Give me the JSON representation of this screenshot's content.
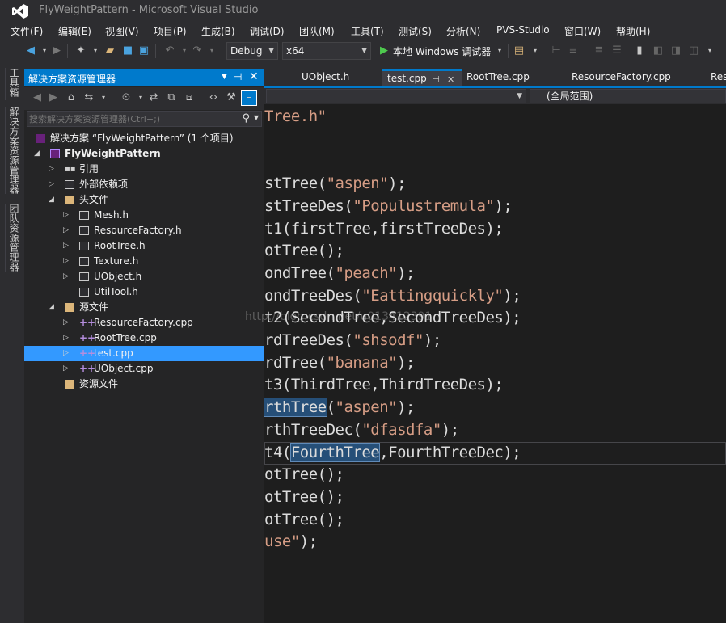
{
  "window": {
    "title": "FlyWeightPattern - Microsoft Visual Studio"
  },
  "menu": [
    "文件(F)",
    "编辑(E)",
    "视图(V)",
    "项目(P)",
    "生成(B)",
    "调试(D)",
    "团队(M)",
    "工具(T)",
    "测试(S)",
    "分析(N)",
    "PVS-Studio",
    "窗口(W)",
    "帮助(H)"
  ],
  "toolbar": {
    "config": "Debug",
    "platform": "x64",
    "debugger": "本地 Windows 调试器"
  },
  "side_tabs": [
    "工具箱",
    "解决方案资源管理器",
    "团队资源管理器"
  ],
  "solution_explorer": {
    "title": "解决方案资源管理器",
    "search_placeholder": "搜索解决方案资源管理器(Ctrl+;)",
    "items": [
      {
        "label": "解决方案 “FlyWeightPattern” (1 个项目)",
        "depth": 0,
        "icon": "solution-icon",
        "expander": ""
      },
      {
        "label": "FlyWeightPattern",
        "depth": 1,
        "icon": "project-icon",
        "expander": "expanded",
        "bold": true
      },
      {
        "label": "引用",
        "depth": 2,
        "icon": "references-icon",
        "expander": "collapsed"
      },
      {
        "label": "外部依赖项",
        "depth": 2,
        "icon": "external-deps-icon",
        "expander": "collapsed"
      },
      {
        "label": "头文件",
        "depth": 2,
        "icon": "folder-icon",
        "expander": "expanded"
      },
      {
        "label": "Mesh.h",
        "depth": 3,
        "icon": "header-file-icon",
        "expander": "collapsed"
      },
      {
        "label": "ResourceFactory.h",
        "depth": 3,
        "icon": "header-file-icon",
        "expander": "collapsed"
      },
      {
        "label": "RootTree.h",
        "depth": 3,
        "icon": "header-file-icon",
        "expander": "collapsed"
      },
      {
        "label": "Texture.h",
        "depth": 3,
        "icon": "header-file-icon",
        "expander": "collapsed"
      },
      {
        "label": "UObject.h",
        "depth": 3,
        "icon": "header-file-icon",
        "expander": "collapsed"
      },
      {
        "label": "UtilTool.h",
        "depth": 3,
        "icon": "header-file-icon",
        "expander": ""
      },
      {
        "label": "源文件",
        "depth": 2,
        "icon": "folder-icon",
        "expander": "expanded"
      },
      {
        "label": "ResourceFactory.cpp",
        "depth": 3,
        "icon": "cpp-file-icon",
        "expander": "collapsed"
      },
      {
        "label": "RootTree.cpp",
        "depth": 3,
        "icon": "cpp-file-icon",
        "expander": "collapsed"
      },
      {
        "label": "test.cpp",
        "depth": 3,
        "icon": "cpp-file-icon",
        "expander": "collapsed",
        "selected": true
      },
      {
        "label": "UObject.cpp",
        "depth": 3,
        "icon": "cpp-file-icon",
        "expander": "collapsed"
      },
      {
        "label": "资源文件",
        "depth": 2,
        "icon": "folder-icon",
        "expander": ""
      }
    ]
  },
  "editor_tabs": [
    "UObject.h",
    "test.cpp",
    "RootTree.cpp",
    "ResourceFactory.cpp",
    "Reso"
  ],
  "nav": {
    "scope": "(全局范围)"
  },
  "code_lines": [
    {
      "parts": [
        {
          "t": "Tree.h\"",
          "c": "str"
        }
      ]
    },
    {
      "parts": []
    },
    {
      "parts": []
    },
    {
      "parts": [
        {
          "t": "stTree("
        },
        {
          "t": "\"aspen\"",
          "c": "str"
        },
        {
          "t": ");"
        }
      ]
    },
    {
      "parts": [
        {
          "t": "stTreeDes("
        },
        {
          "t": "\"Populustremula\"",
          "c": "str"
        },
        {
          "t": ");"
        }
      ]
    },
    {
      "parts": [
        {
          "t": "t1(firstTree,firstTreeDes);"
        }
      ]
    },
    {
      "parts": [
        {
          "t": "otTree();"
        }
      ]
    },
    {
      "parts": [
        {
          "t": "ondTree("
        },
        {
          "t": "\"peach\"",
          "c": "str"
        },
        {
          "t": ");"
        }
      ]
    },
    {
      "parts": [
        {
          "t": "ondTreeDes("
        },
        {
          "t": "\"Eattingquickly\"",
          "c": "str"
        },
        {
          "t": ");"
        }
      ]
    },
    {
      "parts": [
        {
          "t": "t2(SecondTree,SecondTreeDes);"
        }
      ]
    },
    {
      "parts": [
        {
          "t": "rdTreeDes("
        },
        {
          "t": "\"shsodf\"",
          "c": "str"
        },
        {
          "t": ");"
        }
      ]
    },
    {
      "parts": [
        {
          "t": "rdTree("
        },
        {
          "t": "\"banana\"",
          "c": "str"
        },
        {
          "t": ");"
        }
      ]
    },
    {
      "parts": [
        {
          "t": "t3(ThirdTree,ThirdTreeDes);"
        }
      ]
    },
    {
      "parts": [
        {
          "t": "rthTree",
          "c": "hl"
        },
        {
          "t": "("
        },
        {
          "t": "\"aspen\"",
          "c": "str"
        },
        {
          "t": ");"
        }
      ]
    },
    {
      "parts": [
        {
          "t": "rthTreeDec("
        },
        {
          "t": "\"dfasdfa\"",
          "c": "str"
        },
        {
          "t": ");"
        }
      ]
    },
    {
      "parts": [
        {
          "t": "t4("
        },
        {
          "t": "FourthTree",
          "c": "hl"
        },
        {
          "t": ",FourthTreeDec);"
        }
      ]
    },
    {
      "parts": [
        {
          "t": "otTree();"
        }
      ]
    },
    {
      "parts": [
        {
          "t": "otTree();"
        }
      ]
    },
    {
      "parts": [
        {
          "t": "otTree();"
        }
      ]
    },
    {
      "parts": [
        {
          "t": "use\"",
          "c": "str"
        },
        {
          "t": ");"
        }
      ]
    }
  ],
  "watermark": "http://blog.csdn.net/u013412391",
  "colors": {
    "accent": "#007acc",
    "selection": "#3399ff",
    "editor_bg": "#1e1e1e",
    "string": "#d69d85"
  }
}
